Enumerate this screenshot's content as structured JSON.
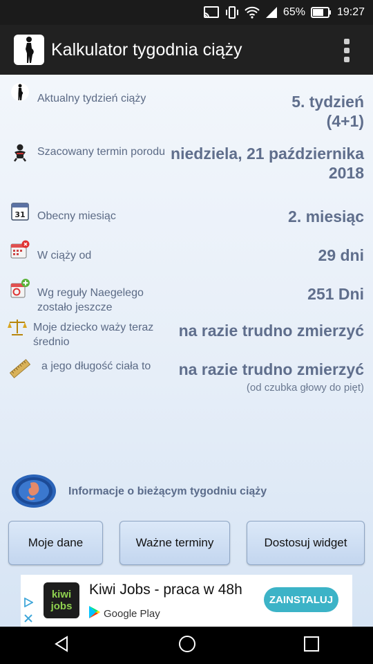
{
  "status_bar": {
    "battery": "65%",
    "time": "19:27"
  },
  "app_bar": {
    "title": "Kalkulator tygodnia ciąży"
  },
  "rows": [
    {
      "icon": "pregnant-silhouette-icon",
      "label": "Aktualny tydzień ciąży",
      "value": "5. tydzień\n(4+1)"
    },
    {
      "icon": "baby-icon",
      "label": "Szacowany termin porodu",
      "value": "niedziela, 21 października 2018"
    },
    {
      "icon": "calendar-icon",
      "label": "Obecny miesiąc",
      "value": "2. miesiąc"
    },
    {
      "icon": "calendar-alert-icon",
      "label": "W ciąży od",
      "value": "29 dni"
    },
    {
      "icon": "calendar-add-icon",
      "label": "Wg reguły Naegelego zostało jeszcze",
      "value": "251 Dni"
    },
    {
      "icon": "scale-icon",
      "label": "Moje dziecko waży teraz średnio",
      "value": "na razie trudno zmierzyć"
    },
    {
      "icon": "ruler-icon",
      "label": "a jego długość ciała to",
      "value": "na razie trudno zmierzyć",
      "sub": "(od czubka głowy do pięt)"
    }
  ],
  "info": {
    "text": "Informacje o bieżącym tygodniu ciąży"
  },
  "buttons": {
    "my_data": "Moje dane",
    "important_dates": "Ważne terminy",
    "customize_widget": "Dostosuj widget"
  },
  "ad": {
    "logo_line1": "kiwi",
    "logo_line2": "jobs",
    "title": "Kiwi Jobs - praca w 48h",
    "store": "Google Play",
    "install": "ZAINSTALUJ"
  },
  "colors": {
    "app_bar": "#212121",
    "value_text": "#5f6e8c",
    "install_button": "#3cb3c7"
  }
}
